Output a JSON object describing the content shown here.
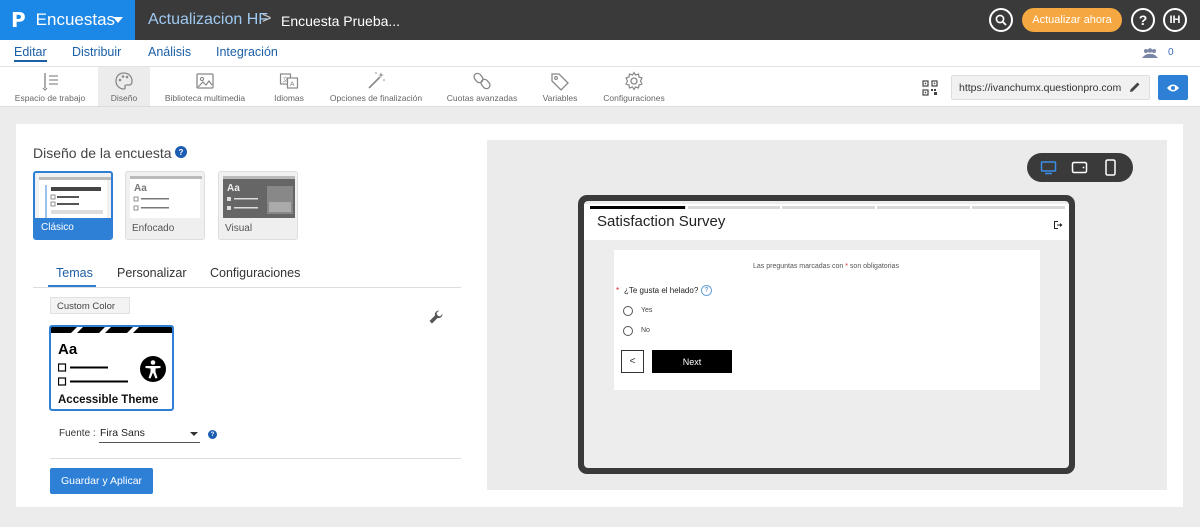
{
  "topbar": {
    "app_name": "Encuestas",
    "crumb_section": "Actualizacion HF",
    "crumb_sep": ">",
    "crumb_survey": "Encuesta Prueba...",
    "update_label": "Actualizar ahora",
    "help_label": "?",
    "user_initials": "IH"
  },
  "menu": {
    "items": [
      "Editar",
      "Distribuir",
      "Análisis",
      "Integración"
    ],
    "active": "Editar",
    "collaborators_count": "0"
  },
  "toolbar": {
    "tools": [
      {
        "label": "Espacio de trabajo",
        "icon": "workspace-icon"
      },
      {
        "label": "Diseño",
        "icon": "palette-icon"
      },
      {
        "label": "Biblioteca multimedia",
        "icon": "image-icon"
      },
      {
        "label": "Idiomas",
        "icon": "language-icon"
      },
      {
        "label": "Opciones de finalización",
        "icon": "magic-wand-icon"
      },
      {
        "label": "Cuotas avanzadas",
        "icon": "link-icon"
      },
      {
        "label": "Variables",
        "icon": "tag-icon"
      },
      {
        "label": "Configuraciones",
        "icon": "gear-icon"
      }
    ],
    "active": "Diseño",
    "survey_url": "https://ivanchumx.questionpro.com"
  },
  "design": {
    "title": "Diseño de la encuesta",
    "help": "?",
    "layouts": [
      "Clásico",
      "Enfocado",
      "Visual"
    ],
    "layout_aa": "Aa",
    "selected_layout": "Clásico",
    "subtabs": [
      "Temas",
      "Personalizar",
      "Configuraciones"
    ],
    "active_subtab": "Temas",
    "custom_color_label": "Custom Color",
    "theme": {
      "aa": "Aa",
      "name": "Accessible Theme"
    },
    "font_label": "Fuente :",
    "font_value": "Fira Sans",
    "font_help": "?",
    "save_label": "Guardar y Aplicar"
  },
  "preview": {
    "survey_title": "Satisfaction Survey",
    "required_note_before": "Las preguntas marcadas con",
    "required_star": "*",
    "required_note_after": "son obligatorias",
    "question_star": "*",
    "question": "¿Te gusta el helado?",
    "question_help": "?",
    "options": [
      "Yes",
      "No"
    ],
    "back_label": "<",
    "next_label": "Next"
  },
  "colors": {
    "brand_blue": "#1b87e6",
    "topbar": "#3a3a3a",
    "accent_orange": "#f5a742",
    "primary_button": "#2e80d7"
  }
}
